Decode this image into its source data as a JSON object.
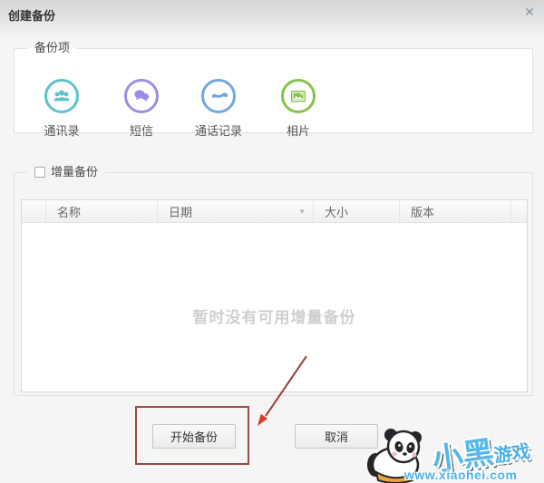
{
  "window": {
    "title": "创建备份",
    "close_icon": "✕"
  },
  "backup_items": {
    "legend": "备份项",
    "items": [
      {
        "label": "通讯录",
        "icon": "contacts-icon",
        "color": "#5cc2cb"
      },
      {
        "label": "短信",
        "icon": "sms-icon",
        "color": "#9b8ee2"
      },
      {
        "label": "通话记录",
        "icon": "call-log-icon",
        "color": "#6fa9dd"
      },
      {
        "label": "相片",
        "icon": "photos-icon",
        "color": "#86c14b"
      }
    ]
  },
  "incremental": {
    "legend": "增量备份",
    "checkbox_checked": false,
    "table": {
      "columns": [
        "名称",
        "日期",
        "大小",
        "版本"
      ],
      "sort_icon": "▼",
      "rows": [],
      "empty_message": "暂时没有可用增量备份"
    }
  },
  "buttons": {
    "start": "开始备份",
    "cancel": "取消"
  },
  "annotation": {
    "rect_color": "#9a4a44",
    "arrow_color": "#99423a",
    "arrowhead_color": "#d63c2b"
  },
  "watermark": {
    "name_part1": "小黑",
    "name_part2": "游戏",
    "url": "www.xiaohei.com"
  }
}
